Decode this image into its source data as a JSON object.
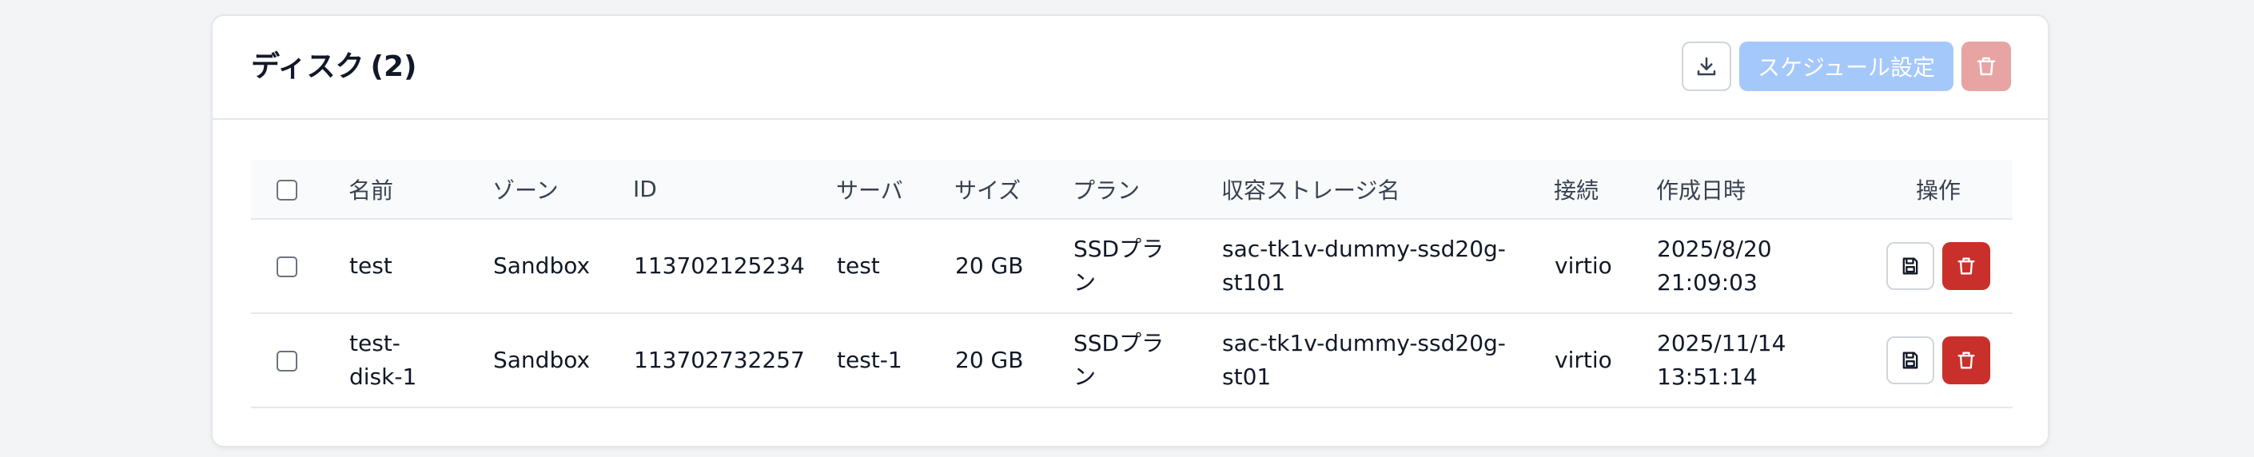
{
  "header": {
    "title": "ディスク",
    "count": "(2)",
    "schedule_label": "スケジュール設定"
  },
  "icons": {
    "download": "download-icon",
    "trash": "trash-icon",
    "save": "save-icon"
  },
  "colors": {
    "schedule_button": "#a5c8fb",
    "delete_disabled": "#e8a3a3",
    "delete": "#c9302c"
  },
  "table": {
    "columns": [
      "名前",
      "ゾーン",
      "ID",
      "サーバ",
      "サイズ",
      "プラン",
      "収容ストレージ名",
      "接続",
      "作成日時",
      "操作"
    ],
    "rows": [
      {
        "name_line1": "test",
        "name_line2": "",
        "zone": "Sandbox",
        "id": "113702125234",
        "server": "test",
        "size": "20 GB",
        "plan_line1": "SSDプラ",
        "plan_line2": "ン",
        "storage_line1": "sac-tk1v-dummy-ssd20g-",
        "storage_line2": "st101",
        "connection": "virtio",
        "created_line1": "2025/8/20",
        "created_line2": "21:09:03"
      },
      {
        "name_line1": "test-",
        "name_line2": "disk-1",
        "zone": "Sandbox",
        "id": "113702732257",
        "server": "test-1",
        "size": "20 GB",
        "plan_line1": "SSDプラ",
        "plan_line2": "ン",
        "storage_line1": "sac-tk1v-dummy-ssd20g-",
        "storage_line2": "st01",
        "connection": "virtio",
        "created_line1": "2025/11/14",
        "created_line2": "13:51:14"
      }
    ]
  }
}
